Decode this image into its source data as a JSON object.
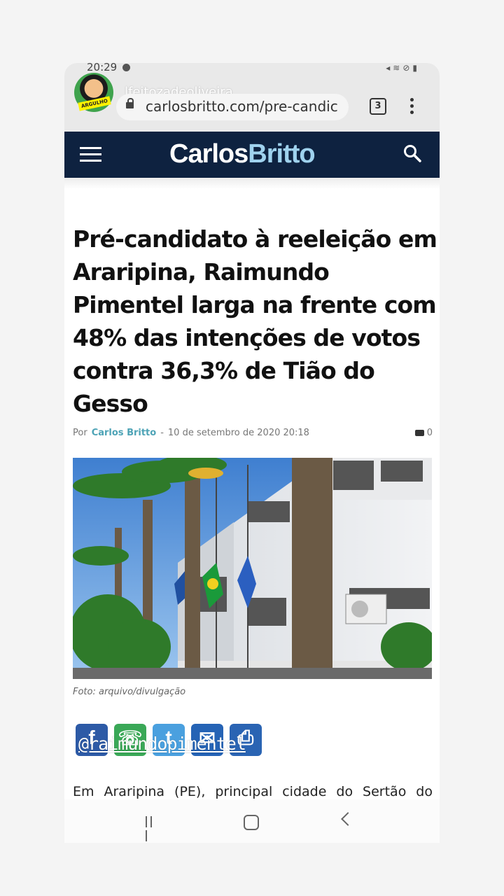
{
  "status_bar": {
    "time": "20:29"
  },
  "story": {
    "username": "lfeitozadeoliveira",
    "mention": "@raimundopimentel",
    "avatar_badge": "ARGULHO"
  },
  "browser": {
    "url": "carlosbritto.com/pre-candic",
    "tab_count": "3"
  },
  "site": {
    "logo_part1": "Carlos",
    "logo_part2": "Britto",
    "brand_color": "#0e2240",
    "accent_color": "#9fd2ee"
  },
  "article": {
    "title": "Pré-candidato à reeleição em Araripina, Raimundo Pimentel larga na frente com 48% das intenções de votos contra 36,3% de Tião do Gesso",
    "by_label": "Por",
    "author": "Carlos Britto",
    "separator": "-",
    "date": "10 de setembro de 2020 20:18",
    "comment_count": "0",
    "photo_caption": "Foto: arquivo/divulgação",
    "body_start": "Em Araripina (PE), principal cidade do Sertão do"
  },
  "share": {
    "facebook": "f",
    "whatsapp": "☏",
    "twitter": "t",
    "email": "✉",
    "print": "⎙"
  }
}
